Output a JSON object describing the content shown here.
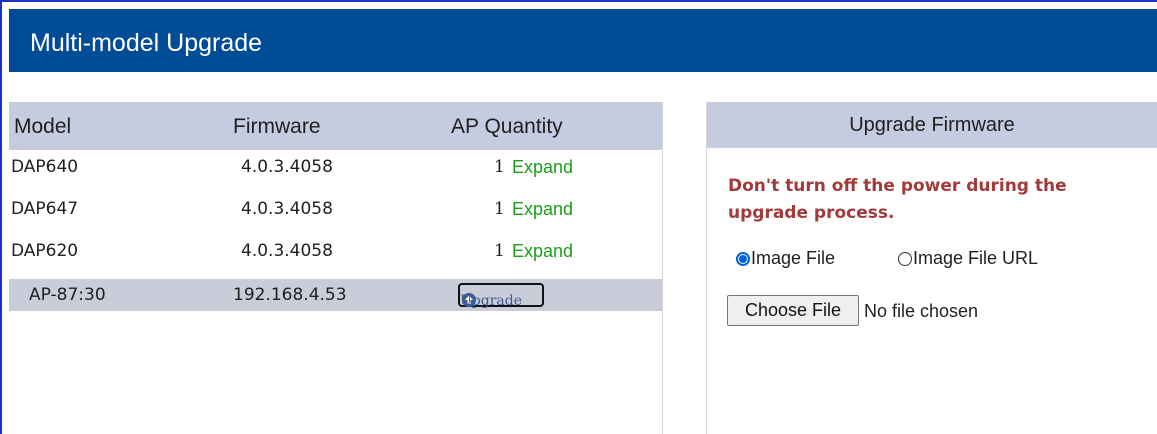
{
  "title": "Multi-model Upgrade",
  "table": {
    "headers": {
      "model": "Model",
      "firmware": "Firmware",
      "ap_quantity": "AP Quantity"
    },
    "rows": [
      {
        "model": "DAP640",
        "firmware": "4.0.3.4058",
        "quantity": "1",
        "expand": "Expand"
      },
      {
        "model": "DAP647",
        "firmware": "4.0.3.4058",
        "quantity": "1",
        "expand": "Expand"
      },
      {
        "model": "DAP620",
        "firmware": "4.0.3.4058",
        "quantity": "1",
        "expand": "Expand"
      }
    ],
    "ap_row": {
      "name": "AP-87:30",
      "ip": "192.168.4.53",
      "upgrade_label": "Upgrade"
    }
  },
  "upgrade_panel": {
    "header": "Upgrade Firmware",
    "warning": "Don't turn off the power during the upgrade process.",
    "radio_image_file": "Image File",
    "radio_image_file_url": "Image File URL",
    "selected_source": "Image File",
    "choose_file_label": "Choose File",
    "no_file_text": "No file chosen"
  },
  "colors": {
    "titlebar": "#004c97",
    "panel_header": "#c5cce0",
    "expand_link": "#1a9e1a",
    "warning": "#a33a3a",
    "radio_accent": "#0060df"
  }
}
